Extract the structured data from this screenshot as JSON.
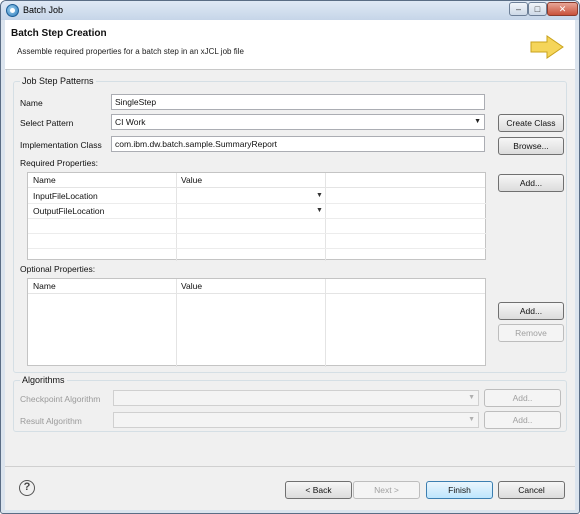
{
  "window": {
    "title": "Batch Job"
  },
  "banner": {
    "title": "Batch Step Creation",
    "description": "Assemble required properties for a batch step in an xJCL job file"
  },
  "job_step_patterns": {
    "group_title": "Job Step Patterns",
    "name_label": "Name",
    "name_value": "SingleStep",
    "select_pattern_label": "Select Pattern",
    "select_pattern_value": "CI Work",
    "create_class_label": "Create Class",
    "implementation_class_label": "Implementation Class",
    "implementation_class_value": "com.ibm.dw.batch.sample.SummaryReport",
    "browse_label": "Browse...",
    "required_properties_label": "Required Properties:",
    "required_add_label": "Add...",
    "required_table": {
      "columns": [
        "Name",
        "Value"
      ],
      "rows": [
        {
          "name": "InputFileLocation",
          "value": ""
        },
        {
          "name": "OutputFileLocation",
          "value": ""
        }
      ]
    },
    "optional_properties_label": "Optional Properties:",
    "optional_add_label": "Add...",
    "optional_remove_label": "Remove",
    "optional_table": {
      "columns": [
        "Name",
        "Value"
      ],
      "rows": []
    }
  },
  "algorithms": {
    "group_title": "Algorithms",
    "checkpoint_label": "Checkpoint Algorithm",
    "checkpoint_add_label": "Add..",
    "result_label": "Result Algorithm",
    "result_add_label": "Add.."
  },
  "footer": {
    "back_label": "< Back",
    "next_label": "Next >",
    "finish_label": "Finish",
    "cancel_label": "Cancel",
    "help_glyph": "?"
  },
  "titlebar_buttons": {
    "minimize": "–",
    "maximize": "□",
    "close": "✕"
  }
}
